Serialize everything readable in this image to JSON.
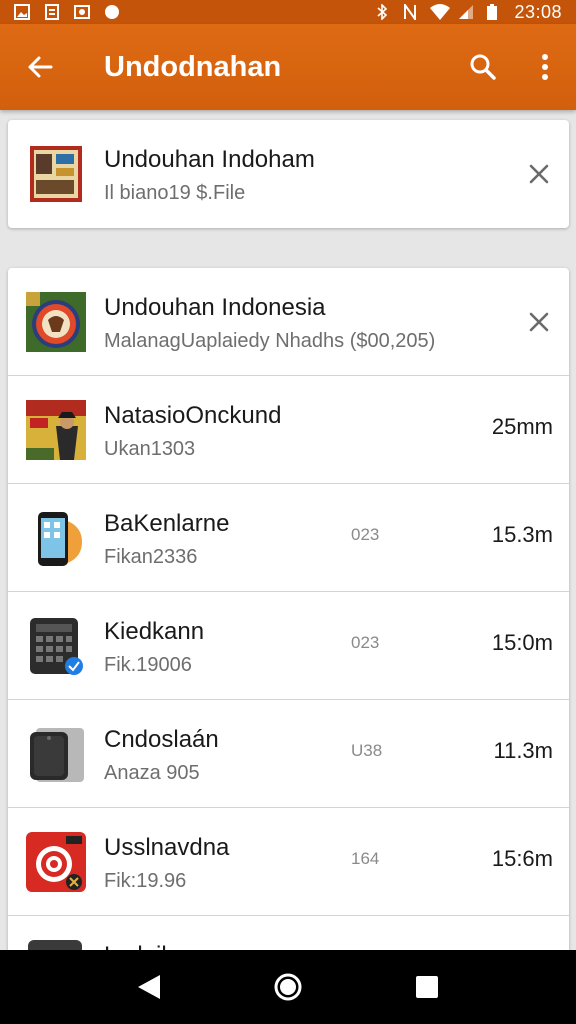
{
  "status_bar": {
    "time": "23:08"
  },
  "app_bar": {
    "title": "Undodnahan"
  },
  "top_card": {
    "title": "Undouhan Indoham",
    "subtitle": "Il biano19 $.File"
  },
  "list": [
    {
      "title": "Undouhan Indonesia",
      "subtitle": "MalanagUaplaiedy Nhadhs ($00,205)",
      "mid": "",
      "size": "",
      "closable": true,
      "icon": "app-thumbnail-icon"
    },
    {
      "title": "NatasioOnckund",
      "subtitle": "Ukan1303",
      "mid": "",
      "size": "25mm",
      "closable": false,
      "icon": "movie-poster-icon"
    },
    {
      "title": "BaKenlarne",
      "subtitle": "Fikan2336",
      "mid": "023",
      "size": "15.3m",
      "closable": false,
      "icon": "phone-icon"
    },
    {
      "title": "Kiedkann",
      "subtitle": "Fik.19006",
      "mid": "023",
      "size": "15:0m",
      "closable": false,
      "icon": "calculator-icon"
    },
    {
      "title": "Cndoslaán",
      "subtitle": "Anaza 905",
      "mid": "U38",
      "size": "11.3m",
      "closable": false,
      "icon": "speaker-icon"
    },
    {
      "title": "Usslnavdna",
      "subtitle": "Fik:19.96",
      "mid": "164",
      "size": "15:6m",
      "closable": false,
      "icon": "target-icon"
    },
    {
      "title": "Lsdnil",
      "subtitle": "",
      "mid": "",
      "size": "",
      "closable": false,
      "icon": "device-icon"
    }
  ],
  "colors": {
    "primary": "#d96410",
    "status_bar": "#c4540a"
  }
}
